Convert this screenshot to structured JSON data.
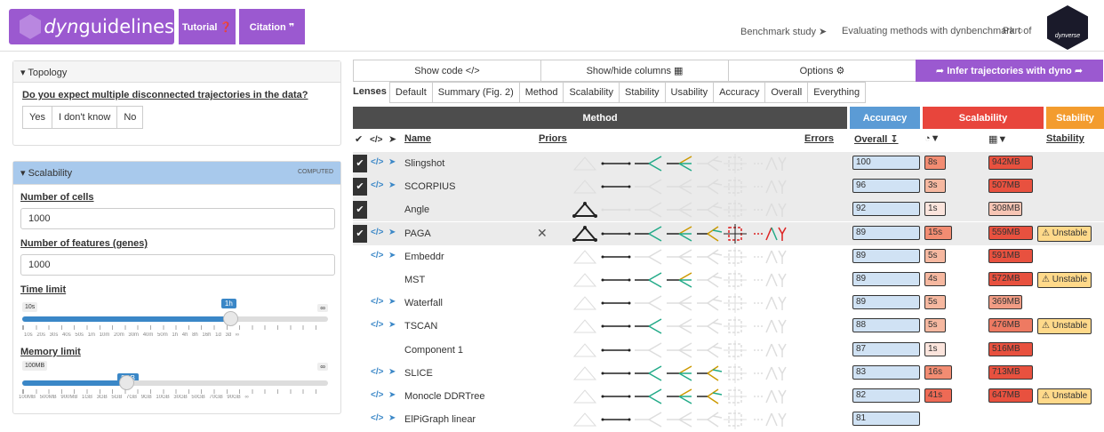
{
  "header": {
    "logo_prefix": "dyn",
    "logo_suffix": "guidelines",
    "tutorial": "Tutorial ❓",
    "citation": "Citation ❞",
    "benchmark": "Benchmark study ➤",
    "evaluating": "Evaluating methods with dynbenchmark ○",
    "part_of": "Part of",
    "dynverse": "dynverse"
  },
  "topology": {
    "title": "▾ Topology",
    "question": "Do you expect multiple disconnected trajectories in the data?",
    "options": [
      "Yes",
      "I don't know",
      "No"
    ]
  },
  "scalability": {
    "title": "▾ Scalability",
    "computed": "COMPUTED",
    "cells_label": "Number of cells",
    "cells_value": "1000",
    "features_label": "Number of features (genes)",
    "features_value": "1000",
    "time_label": "Time limit",
    "time_min": "10s",
    "time_current": "1h",
    "time_max": "∞",
    "time_fraction": 0.68,
    "time_ticks": "10s 20s 30s 40s 50s 1m 10m 20m 30m 40m 50m 1h 4h 8h 16h 1d 3d ∞",
    "memory_label": "Memory limit",
    "memory_min": "100MB",
    "memory_current": "2GB",
    "memory_max": "∞",
    "memory_fraction": 0.34,
    "memory_ticks": "100MB 500MB 900MB 1GB 3GB 5GB 7GB 9GB 10GB 30GB 50GB 70GB 90GB ∞"
  },
  "toolbar": {
    "show_code": "Show code </>",
    "show_hide": "Show/hide columns ▦",
    "options": "Options ⚙",
    "infer": "➦ Infer trajectories with dyno ➦"
  },
  "lenses": {
    "label": "Lenses",
    "items": [
      "Default",
      "Summary (Fig. 2)",
      "Method",
      "Scalability",
      "Stability",
      "Usability",
      "Accuracy",
      "Overall",
      "Everything"
    ]
  },
  "bands": {
    "method": "Method",
    "accuracy": "Accuracy",
    "scalability": "Scalability",
    "stability": "Stability",
    "method_color": "#4d4d4d",
    "accuracy_color": "#5b9bd5",
    "scalability_color": "#e8453c",
    "stability_color": "#f39c2e"
  },
  "columns": {
    "check": "✔",
    "code": "</>",
    "send": "➤",
    "name": "Name",
    "priors": "Priors",
    "errors": "Errors",
    "overall": "Overall ↧",
    "time": "◔▼",
    "memory": "▦▼",
    "stability": "Stability"
  },
  "methods": [
    {
      "name": "Slingshot",
      "selected": true,
      "code": true,
      "error": "",
      "overall": "100",
      "time": "8s",
      "memory": "942MB",
      "stability": "",
      "grey": true,
      "traj": [
        1,
        1,
        1,
        1,
        0,
        0
      ]
    },
    {
      "name": "SCORPIUS",
      "selected": true,
      "code": true,
      "error": "",
      "overall": "96",
      "time": "3s",
      "memory": "507MB",
      "stability": "",
      "grey": true,
      "traj": [
        0,
        1,
        0,
        0,
        0,
        0
      ]
    },
    {
      "name": "Angle",
      "selected": true,
      "code": false,
      "error": "",
      "overall": "92",
      "time": "1s",
      "memory": "308MB",
      "stability": "",
      "grey": true,
      "traj": [
        2,
        0,
        0,
        0,
        0,
        0
      ]
    },
    {
      "name": "PAGA",
      "selected": true,
      "code": true,
      "error": "✕",
      "overall": "89",
      "time": "15s",
      "memory": "559MB",
      "stability": "Unstable",
      "grey": true,
      "traj": [
        2,
        1,
        1,
        1,
        1,
        1
      ]
    },
    {
      "name": "Embeddr",
      "selected": false,
      "code": true,
      "error": "",
      "overall": "89",
      "time": "5s",
      "memory": "591MB",
      "stability": "",
      "grey": false,
      "traj": [
        0,
        1,
        0,
        0,
        0,
        0
      ]
    },
    {
      "name": "MST",
      "selected": false,
      "code": false,
      "error": "",
      "overall": "89",
      "time": "4s",
      "memory": "572MB",
      "stability": "Unstable",
      "grey": false,
      "traj": [
        0,
        1,
        1,
        1,
        0,
        0
      ]
    },
    {
      "name": "Waterfall",
      "selected": false,
      "code": true,
      "error": "",
      "overall": "89",
      "time": "5s",
      "memory": "369MB",
      "stability": "",
      "grey": false,
      "traj": [
        0,
        1,
        0,
        0,
        0,
        0
      ]
    },
    {
      "name": "TSCAN",
      "selected": false,
      "code": true,
      "error": "",
      "overall": "88",
      "time": "5s",
      "memory": "476MB",
      "stability": "Unstable",
      "grey": false,
      "traj": [
        0,
        1,
        1,
        0,
        0,
        0
      ]
    },
    {
      "name": "Component 1",
      "selected": false,
      "code": false,
      "error": "",
      "overall": "87",
      "time": "1s",
      "memory": "516MB",
      "stability": "",
      "grey": false,
      "traj": [
        0,
        1,
        0,
        0,
        0,
        0
      ]
    },
    {
      "name": "SLICE",
      "selected": false,
      "code": true,
      "error": "",
      "overall": "83",
      "time": "16s",
      "memory": "713MB",
      "stability": "",
      "grey": false,
      "traj": [
        0,
        1,
        1,
        1,
        1,
        0
      ]
    },
    {
      "name": "Monocle DDRTree",
      "selected": false,
      "code": true,
      "error": "",
      "overall": "82",
      "time": "41s",
      "memory": "647MB",
      "stability": "Unstable",
      "grey": false,
      "traj": [
        0,
        1,
        1,
        1,
        1,
        0
      ]
    },
    {
      "name": "ElPiGraph linear",
      "selected": false,
      "code": true,
      "error": "",
      "overall": "81",
      "time": "",
      "memory": "",
      "stability": "",
      "grey": false,
      "traj": [
        0,
        1,
        0,
        0,
        0,
        0
      ]
    }
  ]
}
